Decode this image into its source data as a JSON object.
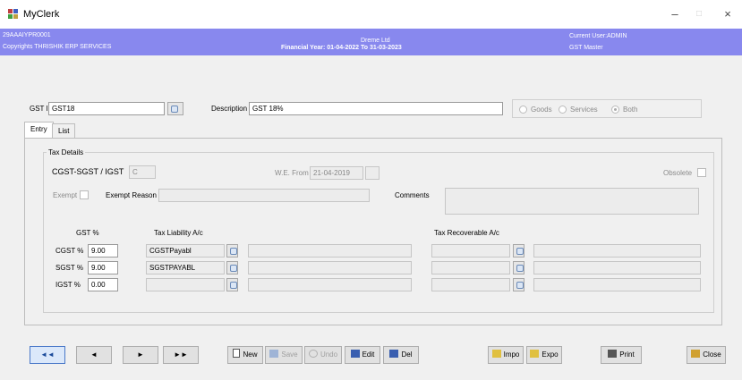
{
  "window": {
    "title": "MyClerk",
    "minimize": "–",
    "maximize": "□",
    "close": "×"
  },
  "header": {
    "user_code": "29AAAIYPR0001",
    "copyright": "Copyrights THRISHIK ERP SERVICES",
    "company": "Dreme Ltd",
    "financial_year": "Financial Year: 01-04-2022 To 31-03-2023",
    "current_user": "Current User:ADMIN",
    "module": "GST Master"
  },
  "form": {
    "gst_id_label": "GST ID",
    "gst_id_value": "GST18",
    "description_label": "Description",
    "description_value": "GST 18%",
    "radio_goods": "Goods",
    "radio_services": "Services",
    "radio_both": "Both",
    "selected_radio": "Both"
  },
  "tabs": [
    {
      "label": "Entry"
    },
    {
      "label": "List"
    }
  ],
  "tax_details": {
    "group_label": "Tax Details",
    "cgst_sgst_label": "CGST-SGST / IGST",
    "cgst_sgst_value": "C",
    "we_from_label": "W.E. From",
    "we_from_value": "21-04-2019",
    "obsolete_label": "Obsolete",
    "exempt_label": "Exempt",
    "exempt_reason_label": "Exempt Reason",
    "comments_label": "Comments"
  },
  "rates": {
    "gst_pct_header": "GST %",
    "liability_header": "Tax Liability A/c",
    "recoverable_header": "Tax Recoverable A/c",
    "rows": [
      {
        "label": "CGST %",
        "value": "9.00",
        "liability": "CGSTPayabl"
      },
      {
        "label": "SGST %",
        "value": "9.00",
        "liability": "SGSTPAYABL"
      },
      {
        "label": "IGST %",
        "value": "0.00",
        "liability": ""
      }
    ]
  },
  "toolbar": {
    "first": "◄◄",
    "prev": "◄",
    "next": "►",
    "last": "►►",
    "new": "New",
    "save": "Save",
    "undo": "Undo",
    "edit": "Edit",
    "delete": "Del",
    "import": "Impo",
    "export": "Expo",
    "print": "Print",
    "close": "Close"
  }
}
